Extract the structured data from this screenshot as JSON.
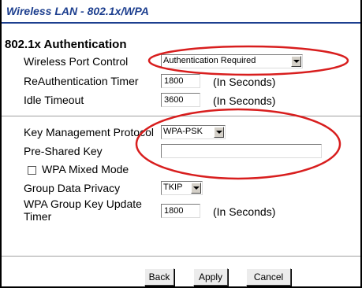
{
  "header": {
    "title": "Wireless LAN - 802.1x/WPA"
  },
  "auth": {
    "section_title": "802.1x Authentication",
    "port_control": {
      "label": "Wireless Port Control",
      "value": "Authentication Required"
    },
    "reauth_timer": {
      "label": "ReAuthentication Timer",
      "value": "1800",
      "unit": "(In Seconds)"
    },
    "idle_timeout": {
      "label": "Idle Timeout",
      "value": "3600",
      "unit": "(In Seconds)"
    }
  },
  "wpa": {
    "key_mgmt": {
      "label": "Key Management Protocol",
      "value": "WPA-PSK"
    },
    "psk": {
      "label": "Pre-Shared Key",
      "value": ""
    },
    "mixed_mode": {
      "label": "WPA Mixed Mode",
      "checked": false
    },
    "group_privacy": {
      "label": "Group Data Privacy",
      "value": "TKIP"
    },
    "group_key_update": {
      "label_line1": "WPA Group Key Update",
      "label_line2": "Timer",
      "value": "1800",
      "unit": "(In Seconds)"
    }
  },
  "buttons": {
    "back": "Back",
    "apply": "Apply",
    "cancel": "Cancel"
  },
  "annotation_color": "#d81e1e"
}
